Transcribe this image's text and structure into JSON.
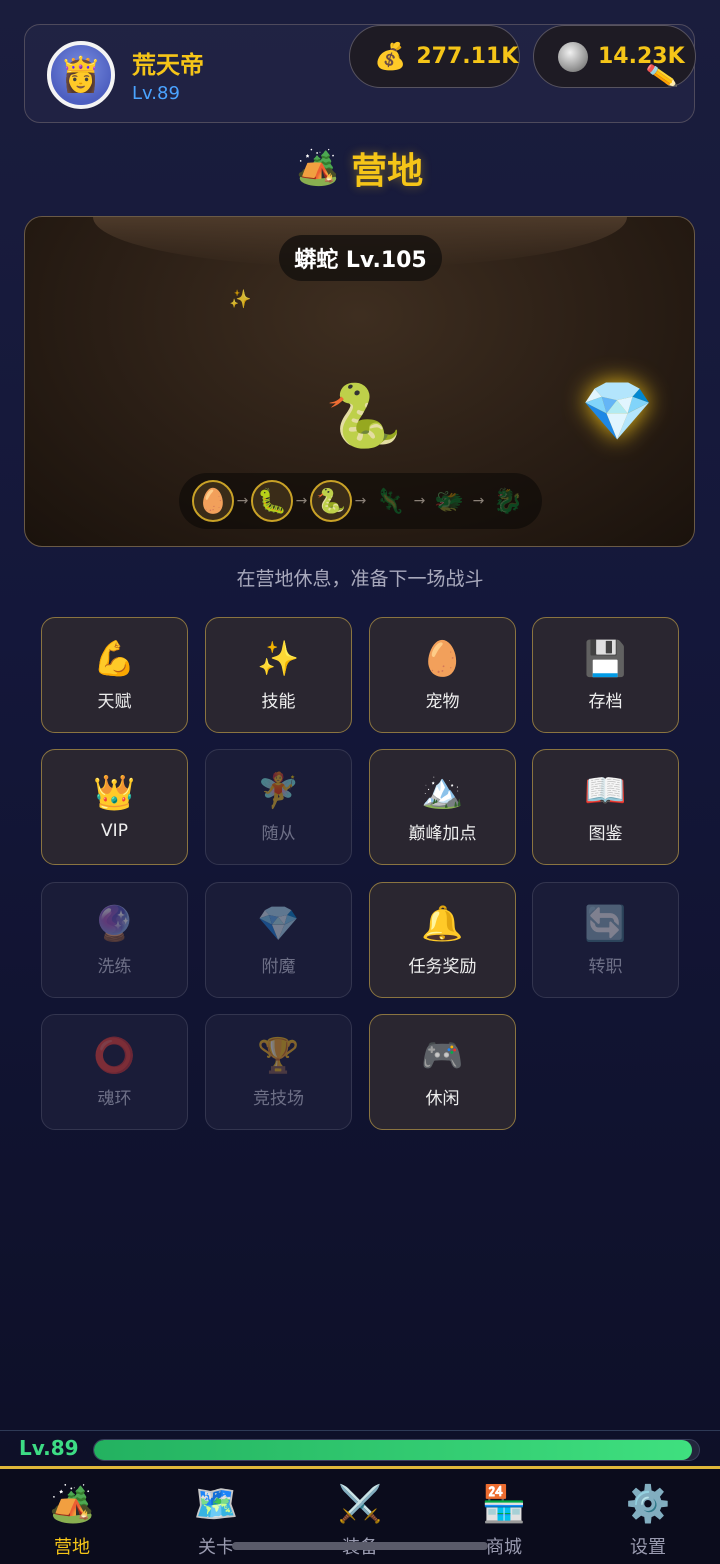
{
  "player": {
    "avatar_icon": "👸",
    "name": "荒天帝",
    "level": "Lv.89"
  },
  "currency": {
    "gold_icon": "💰",
    "gold": "277.11K",
    "silver": "14.23K"
  },
  "page": {
    "title_icon": "🏕️",
    "title": "营地"
  },
  "scene": {
    "pet_label": "蟒蛇 Lv.105",
    "evolution": [
      {
        "icon": "🥚",
        "state": "unlocked"
      },
      {
        "icon": "🐛",
        "state": "unlocked"
      },
      {
        "icon": "🐍",
        "state": "unlocked"
      },
      {
        "icon": "🦎",
        "state": "locked"
      },
      {
        "icon": "🐲",
        "state": "locked"
      },
      {
        "icon": "🐉",
        "state": "locked"
      }
    ],
    "arrow": "→"
  },
  "subtitle": "在营地休息，准备下一场战斗",
  "menu": [
    {
      "icon": "💪",
      "label": "天赋",
      "active": true
    },
    {
      "icon": "✨",
      "label": "技能",
      "active": true
    },
    {
      "icon": "🥚",
      "label": "宠物",
      "active": true
    },
    {
      "icon": "💾",
      "label": "存档",
      "active": true
    },
    {
      "icon": "👑",
      "label": "VIP",
      "active": true
    },
    {
      "icon": "🧚",
      "label": "随从",
      "active": false
    },
    {
      "icon": "🏔️",
      "label": "巅峰加点",
      "active": true
    },
    {
      "icon": "📖",
      "label": "图鉴",
      "active": true
    },
    {
      "icon": "🔮",
      "label": "洗练",
      "active": false
    },
    {
      "icon": "💎",
      "label": "附魔",
      "active": false
    },
    {
      "icon": "🔔",
      "label": "任务奖励",
      "active": true
    },
    {
      "icon": "🔄",
      "label": "转职",
      "active": false
    },
    {
      "icon": "⭕",
      "label": "魂环",
      "active": false
    },
    {
      "icon": "🏆",
      "label": "竞技场",
      "active": false
    },
    {
      "icon": "🎮",
      "label": "休闲",
      "active": true
    }
  ],
  "xp": {
    "level": "Lv.89",
    "progress": 0.988
  },
  "nav": [
    {
      "icon": "🏕️",
      "label": "营地",
      "selected": true
    },
    {
      "icon": "🗺️",
      "label": "关卡",
      "selected": false
    },
    {
      "icon": "⚔️",
      "label": "装备",
      "selected": false
    },
    {
      "icon": "🏪",
      "label": "商城",
      "selected": false
    },
    {
      "icon": "⚙️",
      "label": "设置",
      "selected": false
    }
  ],
  "colors": {
    "accent_gold": "#f5c518",
    "level_blue": "#4aa3ff",
    "xp_green": "#3ddc84"
  }
}
